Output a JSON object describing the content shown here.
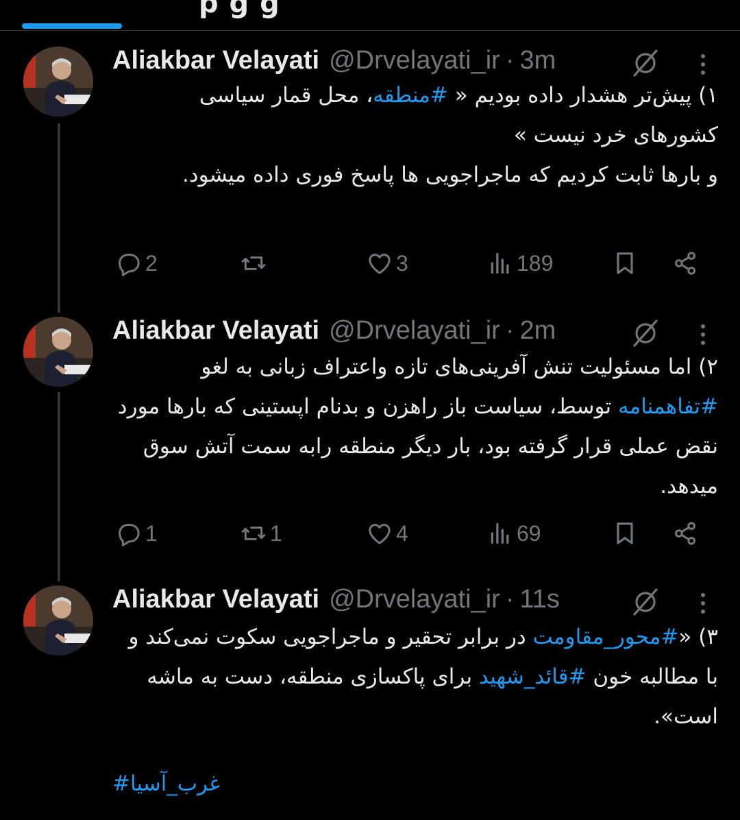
{
  "top": {
    "cut_tab_text": "p  g  g"
  },
  "tweets": [
    {
      "name": "Aliakbar Velayati",
      "handle": "@Drvelayati_ir",
      "time": "3m",
      "body_prefix": "۱) پیش‌تر هشدار داده بودیم « ",
      "hashtag1": "#منطقه",
      "body_suffix": "، محل قمار سیاسی کشورهای خرد نیست »\nو بارها ثابت کردیم که ماجراجویی ها پاسخ فوری داده میشود.",
      "replies": "2",
      "reposts": "",
      "likes": "3",
      "views": "189"
    },
    {
      "name": "Aliakbar Velayati",
      "handle": "@Drvelayati_ir",
      "time": "2m",
      "body_prefix": "۲) اما مسئولیت تنش آفرینی‌های تازه واعتراف زبانی به لغو ",
      "hashtag1": "#تفاهمنامه",
      "body_suffix": "  توسط، سیاست باز راهزن و بدنام اپستینی که بارها مورد نقض عملی قرار گرفته بود، بار دیگر منطقه رابه سمت آتش سوق میدهد.",
      "replies": "1",
      "reposts": "1",
      "likes": "4",
      "views": "69"
    },
    {
      "name": "Aliakbar Velayati",
      "handle": "@Drvelayati_ir",
      "time": "11s",
      "body_prefix": "۳) «",
      "hashtag1": "#محور_مقاومت",
      "body_mid": " در برابر تحقیر و ماجراجویی سکوت نمی‌کند و با مطالبه خون ",
      "hashtag2": "#قائد_شهید",
      "body_suffix": " برای پاکسازی منطقه، دست به ماشه است».",
      "footer_hashtag": "#غرب_آسیا"
    }
  ],
  "colors": {
    "accent": "#1d9bf0",
    "text": "#e7e9ea",
    "muted": "#71767b",
    "bg": "#000000"
  },
  "icons": [
    "reply-icon",
    "repost-icon",
    "like-icon",
    "views-icon",
    "bookmark-icon",
    "share-icon",
    "grok-icon",
    "more-icon"
  ]
}
